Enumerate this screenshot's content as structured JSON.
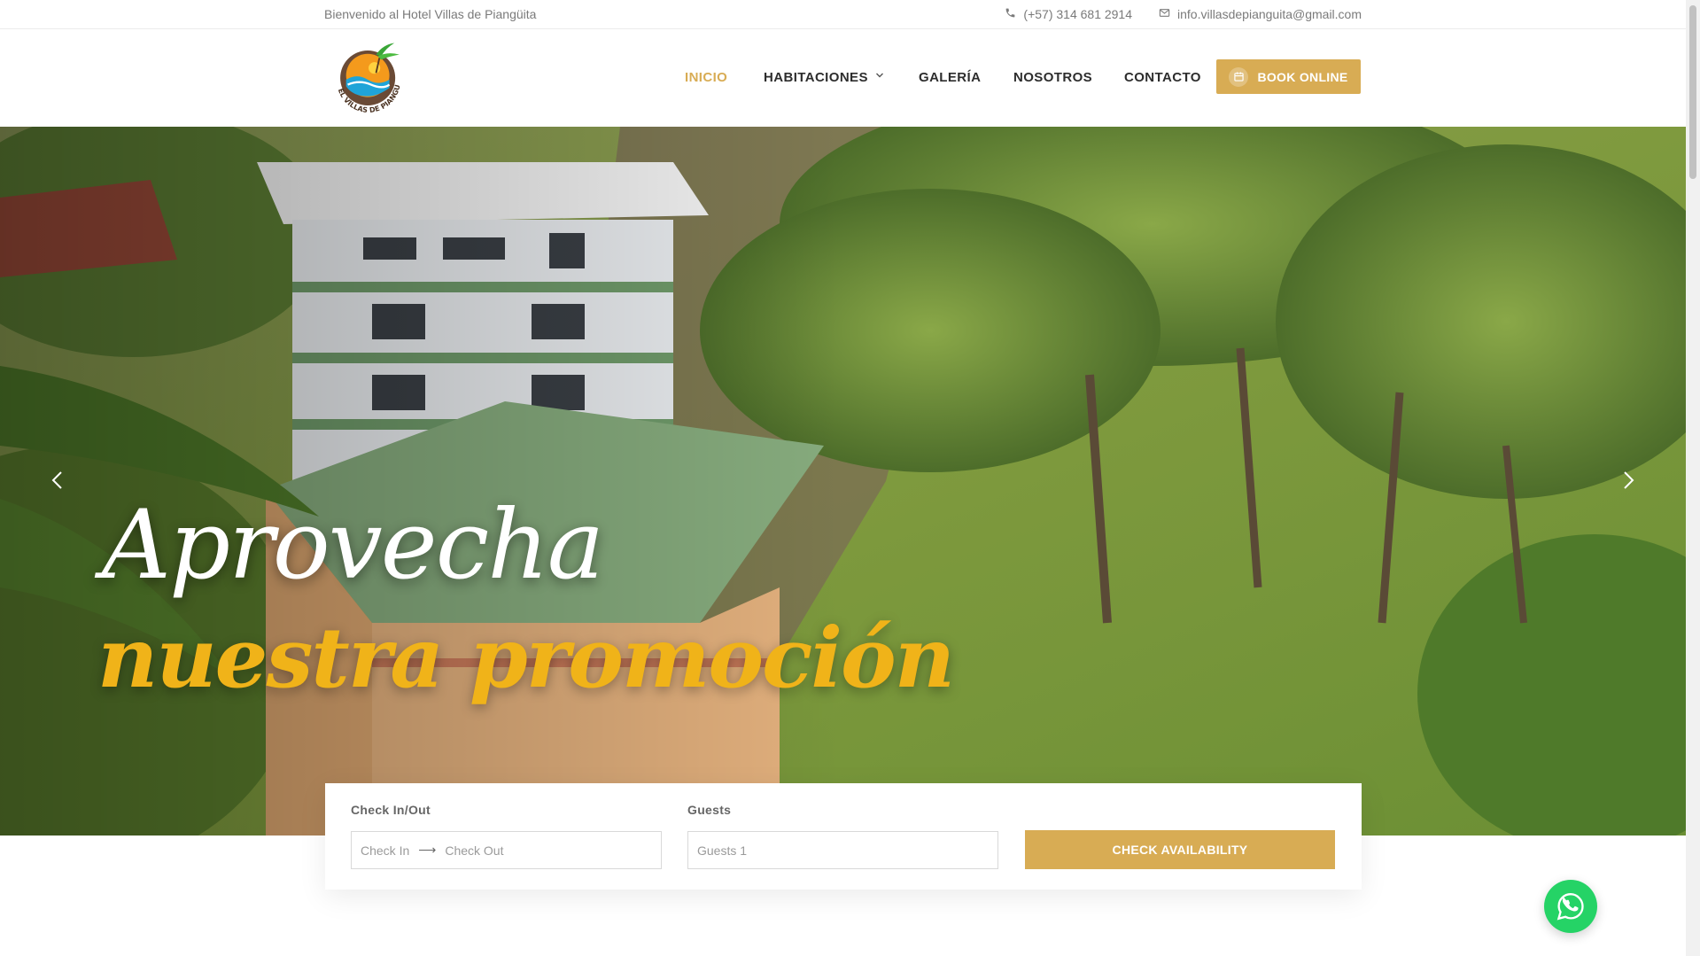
{
  "topbar": {
    "welcome": "Bienvenido al Hotel Villas de Piangüita",
    "phone": "(+57) 314 681 2914",
    "email": "info.villasdepianguita@gmail.com"
  },
  "header": {
    "logo_text": "HOTEL VILLAS DE PIANGUITA",
    "nav": {
      "inicio": "INICIO",
      "habitaciones": "HABITACIONES",
      "galeria": "GALERÍA",
      "nosotros": "NOSOTROS",
      "contacto": "CONTACTO"
    },
    "book_online": "BOOK ONLINE"
  },
  "hero": {
    "line1": "Aprovecha",
    "line2": "nuestra promoción"
  },
  "booking": {
    "checkinout_label": "Check In/Out",
    "checkin_placeholder": "Check In",
    "checkout_placeholder": "Check Out",
    "guests_label": "Guests",
    "guests_value": "Guests 1",
    "check_button": "CHECK AVAILABILITY"
  },
  "colors": {
    "accent": "#d8ac54",
    "promo_yellow": "#f0b319",
    "whatsapp": "#25d366",
    "nav_text": "#2d2d2d"
  },
  "icons": [
    "phone-icon",
    "mail-icon",
    "calendar-icon",
    "chevron-down-icon",
    "arrow-left-icon",
    "arrow-right-icon",
    "whatsapp-icon"
  ]
}
